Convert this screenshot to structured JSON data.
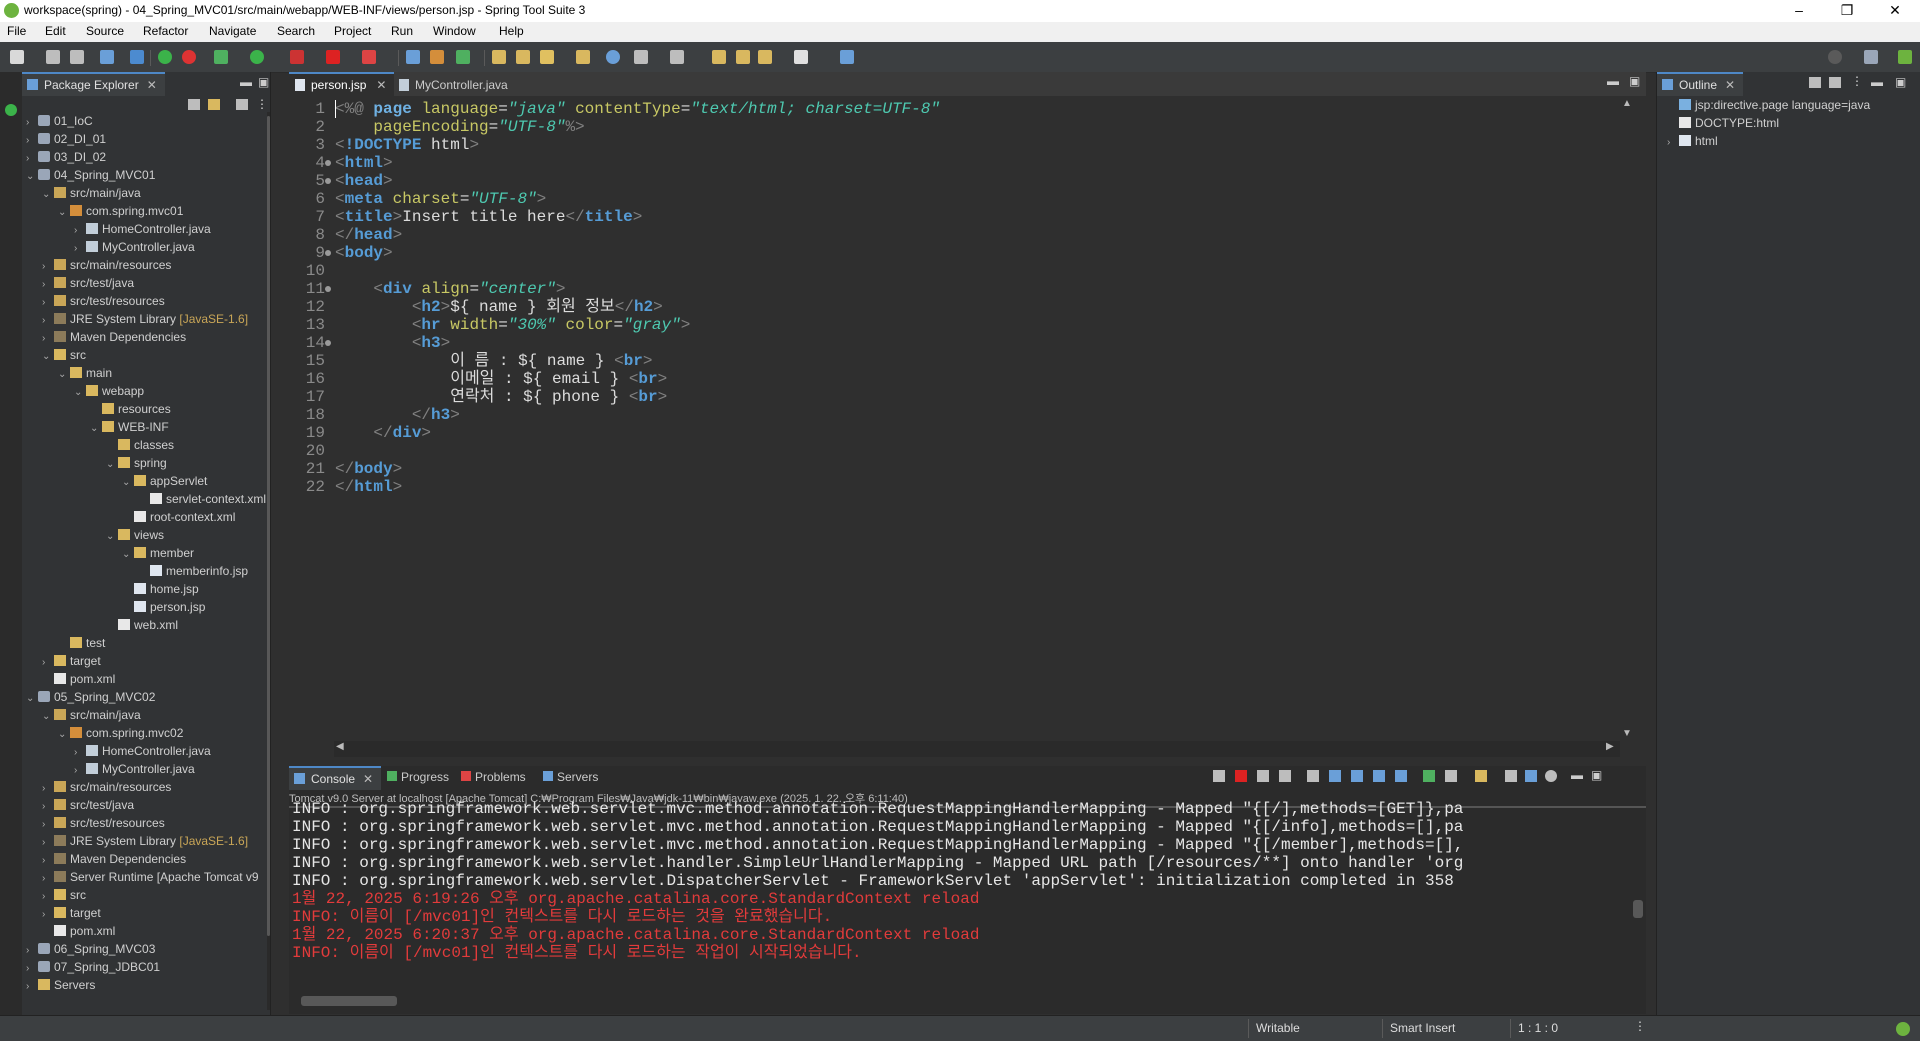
{
  "window": {
    "title": "workspace(spring) - 04_Spring_MVC01/src/main/webapp/WEB-INF/views/person.jsp - Spring Tool Suite 3",
    "minimize": "–",
    "maximize": "❐",
    "close": "✕"
  },
  "menu": [
    "File",
    "Edit",
    "Source",
    "Refactor",
    "Navigate",
    "Search",
    "Project",
    "Run",
    "Window",
    "Help"
  ],
  "package_explorer": {
    "title": "Package Explorer",
    "items": [
      {
        "label": "01_IoC",
        "arrow": "›",
        "icon": "proj",
        "level": 0
      },
      {
        "label": "02_DI_01",
        "arrow": "›",
        "icon": "proj",
        "level": 0
      },
      {
        "label": "03_DI_02",
        "arrow": "›",
        "icon": "proj",
        "level": 0
      },
      {
        "label": "04_Spring_MVC01",
        "arrow": "⌄",
        "icon": "proj",
        "level": 0
      },
      {
        "label": "src/main/java",
        "arrow": "⌄",
        "icon": "src",
        "level": 1
      },
      {
        "label": "com.spring.mvc01",
        "arrow": "⌄",
        "icon": "pkg",
        "level": 2
      },
      {
        "label": "HomeController.java",
        "arrow": "›",
        "icon": "java",
        "level": 3
      },
      {
        "label": "MyController.java",
        "arrow": "›",
        "icon": "java",
        "level": 3
      },
      {
        "label": "src/main/resources",
        "arrow": "›",
        "icon": "src",
        "level": 1
      },
      {
        "label": "src/test/java",
        "arrow": "›",
        "icon": "src",
        "level": 1
      },
      {
        "label": "src/test/resources",
        "arrow": "›",
        "icon": "src",
        "level": 1
      },
      {
        "label": "JRE System Library",
        "deco": " [JavaSE-1.6]",
        "arrow": "›",
        "icon": "lib",
        "level": 1
      },
      {
        "label": "Maven Dependencies",
        "arrow": "›",
        "icon": "lib",
        "level": 1
      },
      {
        "label": "src",
        "arrow": "⌄",
        "icon": "folder",
        "level": 1
      },
      {
        "label": "main",
        "arrow": "⌄",
        "icon": "folder",
        "level": 2
      },
      {
        "label": "webapp",
        "arrow": "⌄",
        "icon": "folder",
        "level": 3
      },
      {
        "label": "resources",
        "arrow": "",
        "icon": "folder",
        "level": 4
      },
      {
        "label": "WEB-INF",
        "arrow": "⌄",
        "icon": "folder",
        "level": 4
      },
      {
        "label": "classes",
        "arrow": "",
        "icon": "folder",
        "level": 5
      },
      {
        "label": "spring",
        "arrow": "⌄",
        "icon": "folder",
        "level": 5
      },
      {
        "label": "appServlet",
        "arrow": "⌄",
        "icon": "folder",
        "level": 6
      },
      {
        "label": "servlet-context.xml",
        "arrow": "",
        "icon": "xml",
        "level": 7
      },
      {
        "label": "root-context.xml",
        "arrow": "",
        "icon": "xml",
        "level": 6
      },
      {
        "label": "views",
        "arrow": "⌄",
        "icon": "folder",
        "level": 5
      },
      {
        "label": "member",
        "arrow": "⌄",
        "icon": "folder",
        "level": 6
      },
      {
        "label": "memberinfo.jsp",
        "arrow": "",
        "icon": "jsp",
        "level": 7
      },
      {
        "label": "home.jsp",
        "arrow": "",
        "icon": "jsp",
        "level": 6
      },
      {
        "label": "person.jsp",
        "arrow": "",
        "icon": "jsp",
        "level": 6
      },
      {
        "label": "web.xml",
        "arrow": "",
        "icon": "xml",
        "level": 5
      },
      {
        "label": "test",
        "arrow": "",
        "icon": "folder",
        "level": 2
      },
      {
        "label": "target",
        "arrow": "›",
        "icon": "folder",
        "level": 1
      },
      {
        "label": "pom.xml",
        "arrow": "",
        "icon": "xml",
        "level": 1
      },
      {
        "label": "05_Spring_MVC02",
        "arrow": "⌄",
        "icon": "proj",
        "level": 0
      },
      {
        "label": "src/main/java",
        "arrow": "⌄",
        "icon": "src",
        "level": 1
      },
      {
        "label": "com.spring.mvc02",
        "arrow": "⌄",
        "icon": "pkg",
        "level": 2
      },
      {
        "label": "HomeController.java",
        "arrow": "›",
        "icon": "java",
        "level": 3
      },
      {
        "label": "MyController.java",
        "arrow": "›",
        "icon": "java",
        "level": 3
      },
      {
        "label": "src/main/resources",
        "arrow": "›",
        "icon": "src",
        "level": 1
      },
      {
        "label": "src/test/java",
        "arrow": "›",
        "icon": "src",
        "level": 1
      },
      {
        "label": "src/test/resources",
        "arrow": "›",
        "icon": "src",
        "level": 1
      },
      {
        "label": "JRE System Library",
        "deco": " [JavaSE-1.6]",
        "arrow": "›",
        "icon": "lib",
        "level": 1
      },
      {
        "label": "Maven Dependencies",
        "arrow": "›",
        "icon": "lib",
        "level": 1
      },
      {
        "label": "Server Runtime [Apache Tomcat v9",
        "arrow": "›",
        "icon": "lib",
        "level": 1
      },
      {
        "label": "src",
        "arrow": "›",
        "icon": "folder",
        "level": 1
      },
      {
        "label": "target",
        "arrow": "›",
        "icon": "folder",
        "level": 1
      },
      {
        "label": "pom.xml",
        "arrow": "",
        "icon": "xml",
        "level": 1
      },
      {
        "label": "06_Spring_MVC03",
        "arrow": "›",
        "icon": "proj",
        "level": 0
      },
      {
        "label": "07_Spring_JDBC01",
        "arrow": "›",
        "icon": "proj",
        "level": 0
      },
      {
        "label": "Servers",
        "arrow": "›",
        "icon": "folder",
        "level": 0
      }
    ]
  },
  "editor": {
    "tabs": [
      {
        "label": "person.jsp",
        "active": true
      },
      {
        "label": "MyController.java",
        "active": false
      }
    ],
    "lines": [
      {
        "n": "1",
        "fold": false,
        "html": "<span class=\"bracket\">&lt;%@</span> <span class=\"dir\">page</span> <span class=\"attr\">language</span>=<span class=\"val\">\"java\"</span> <span class=\"attr\">contentType</span>=<span class=\"val\">\"text/html; charset=UTF-8\"</span>"
      },
      {
        "n": "2",
        "fold": false,
        "html": "    <span class=\"attr\">pageEncoding</span>=<span class=\"val\">\"UTF-8\"</span><span class=\"bracket\">%&gt;</span>"
      },
      {
        "n": "3",
        "fold": false,
        "html": "<span class=\"bracket\">&lt;</span><span class=\"tag\">!DOCTYPE</span> html<span class=\"bracket\">&gt;</span>"
      },
      {
        "n": "4",
        "fold": true,
        "html": "<span class=\"bracket\">&lt;</span><span class=\"tag\">html</span><span class=\"bracket\">&gt;</span>"
      },
      {
        "n": "5",
        "fold": true,
        "html": "<span class=\"bracket\">&lt;</span><span class=\"tag\">head</span><span class=\"bracket\">&gt;</span>"
      },
      {
        "n": "6",
        "fold": false,
        "html": "<span class=\"bracket\">&lt;</span><span class=\"tag\">meta</span> <span class=\"attr\">charset</span>=<span class=\"val\">\"UTF-8\"</span><span class=\"bracket\">&gt;</span>"
      },
      {
        "n": "7",
        "fold": false,
        "html": "<span class=\"bracket\">&lt;</span><span class=\"tag\">title</span><span class=\"bracket\">&gt;</span>Insert title here<span class=\"bracket\">&lt;/</span><span class=\"tag\">title</span><span class=\"bracket\">&gt;</span>"
      },
      {
        "n": "8",
        "fold": false,
        "html": "<span class=\"bracket\">&lt;/</span><span class=\"tag\">head</span><span class=\"bracket\">&gt;</span>"
      },
      {
        "n": "9",
        "fold": true,
        "html": "<span class=\"bracket\">&lt;</span><span class=\"tag\">body</span><span class=\"bracket\">&gt;</span>"
      },
      {
        "n": "10",
        "fold": false,
        "html": ""
      },
      {
        "n": "11",
        "fold": true,
        "html": "    <span class=\"bracket\">&lt;</span><span class=\"tag\">div</span> <span class=\"attr\">align</span>=<span class=\"val\">\"center\"</span><span class=\"bracket\">&gt;</span>"
      },
      {
        "n": "12",
        "fold": false,
        "html": "        <span class=\"bracket\">&lt;</span><span class=\"tag\">h2</span><span class=\"bracket\">&gt;</span>${ name } 회원 정보<span class=\"bracket\">&lt;/</span><span class=\"tag\">h2</span><span class=\"bracket\">&gt;</span>"
      },
      {
        "n": "13",
        "fold": false,
        "html": "        <span class=\"bracket\">&lt;</span><span class=\"tag\">hr</span> <span class=\"attr\">width</span>=<span class=\"val\">\"30%\"</span> <span class=\"attr\">color</span>=<span class=\"val\">\"gray\"</span><span class=\"bracket\">&gt;</span>"
      },
      {
        "n": "14",
        "fold": true,
        "html": "        <span class=\"bracket\">&lt;</span><span class=\"tag\">h3</span><span class=\"bracket\">&gt;</span>"
      },
      {
        "n": "15",
        "fold": false,
        "html": "            이 름 : ${ name } <span class=\"bracket\">&lt;</span><span class=\"tag\">br</span><span class=\"bracket\">&gt;</span>"
      },
      {
        "n": "16",
        "fold": false,
        "html": "            이메일 : ${ email } <span class=\"bracket\">&lt;</span><span class=\"tag\">br</span><span class=\"bracket\">&gt;</span>"
      },
      {
        "n": "17",
        "fold": false,
        "html": "            연락처 : ${ phone } <span class=\"bracket\">&lt;</span><span class=\"tag\">br</span><span class=\"bracket\">&gt;</span>"
      },
      {
        "n": "18",
        "fold": false,
        "html": "        <span class=\"bracket\">&lt;/</span><span class=\"tag\">h3</span><span class=\"bracket\">&gt;</span>"
      },
      {
        "n": "19",
        "fold": false,
        "html": "    <span class=\"bracket\">&lt;/</span><span class=\"tag\">div</span><span class=\"bracket\">&gt;</span>"
      },
      {
        "n": "20",
        "fold": false,
        "html": ""
      },
      {
        "n": "21",
        "fold": false,
        "html": "<span class=\"bracket\">&lt;/</span><span class=\"tag\">body</span><span class=\"bracket\">&gt;</span>"
      },
      {
        "n": "22",
        "fold": false,
        "html": "<span class=\"bracket\">&lt;/</span><span class=\"tag\">html</span><span class=\"bracket\">&gt;</span>"
      }
    ]
  },
  "outline": {
    "title": "Outline",
    "items": [
      {
        "label": "jsp:directive.page language=java",
        "arrow": ""
      },
      {
        "label": "DOCTYPE:html",
        "arrow": ""
      },
      {
        "label": "html",
        "arrow": "›"
      }
    ]
  },
  "console": {
    "tabs": [
      "Console",
      "Progress",
      "Problems",
      "Servers"
    ],
    "server_label": "Tomcat v9.0 Server at localhost [Apache Tomcat] C:₩Program Files₩Java₩jdk-11₩bin₩javaw.exe  (2025. 1. 22. 오후 6:11:40)",
    "lines": [
      {
        "text": "INFO : org.springframework.web.servlet.mvc.method.annotation.RequestMappingHandlerMapping - Mapped \"{[/],methods=[GET]},pa",
        "err": false
      },
      {
        "text": "INFO : org.springframework.web.servlet.mvc.method.annotation.RequestMappingHandlerMapping - Mapped \"{[/info],methods=[],pa",
        "err": false
      },
      {
        "text": "INFO : org.springframework.web.servlet.mvc.method.annotation.RequestMappingHandlerMapping - Mapped \"{[/member],methods=[],",
        "err": false
      },
      {
        "text": "INFO : org.springframework.web.servlet.handler.SimpleUrlHandlerMapping - Mapped URL path [/resources/**] onto handler 'org",
        "err": false
      },
      {
        "text": "INFO : org.springframework.web.servlet.DispatcherServlet - FrameworkServlet 'appServlet': initialization completed in 358",
        "err": false
      },
      {
        "text": "1월 22, 2025 6:19:26 오후 org.apache.catalina.core.StandardContext reload",
        "err": true
      },
      {
        "text": "INFO: 이름이 [/mvc01]인 컨텍스트를 다시 로드하는 것을 완료했습니다.",
        "err": true
      },
      {
        "text": "1월 22, 2025 6:20:37 오후 org.apache.catalina.core.StandardContext reload",
        "err": true
      },
      {
        "text": "INFO: 이름이 [/mvc01]인 컨텍스트를 다시 로드하는 작업이 시작되었습니다.",
        "err": true
      }
    ]
  },
  "statusbar": {
    "writable": "Writable",
    "insert_mode": "Smart Insert",
    "position": "1 : 1 : 0"
  }
}
